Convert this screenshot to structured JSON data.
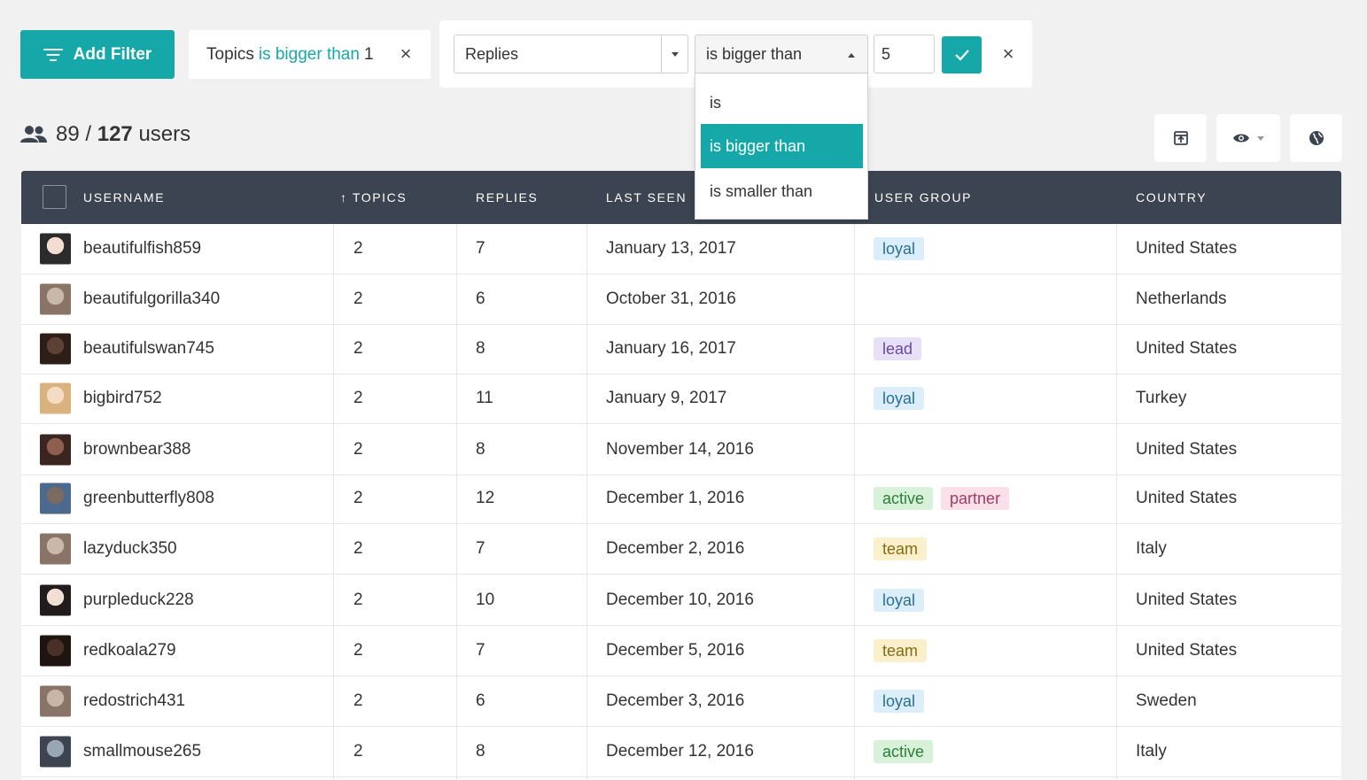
{
  "colors": {
    "accent": "#16a8a8",
    "header_bg": "#3b4450",
    "tag_loyal_bg": "#dbeefa",
    "tag_lead_bg": "#e8e0f7",
    "tag_active_bg": "#d7f2d9",
    "tag_partner_bg": "#fbe0ea",
    "tag_team_bg": "#fbf0cc"
  },
  "toolbar": {
    "add_filter_label": "Add Filter",
    "active_filter": {
      "field": "Topics",
      "operator": "is bigger than",
      "value": "1"
    }
  },
  "filter_editor": {
    "field_value": "Replies",
    "operator_value": "is bigger than",
    "value": "5",
    "operator_options": [
      "is",
      "is bigger than",
      "is smaller than"
    ],
    "selected_option_index": 1
  },
  "summary": {
    "shown": "89",
    "separator": "/",
    "total": "127",
    "unit": "users"
  },
  "table": {
    "columns": {
      "username": "USERNAME",
      "topics": "↑ TOPICS",
      "replies": "REPLIES",
      "last_seen": "LAST SEEN",
      "user_group": "USER GROUP",
      "country": "COUNTRY"
    },
    "rows": [
      {
        "username": "beautifulfish859",
        "topics": "2",
        "replies": "7",
        "last_seen": "January 13, 2017",
        "groups": [
          "loyal"
        ],
        "country": "United States"
      },
      {
        "username": "beautifulgorilla340",
        "topics": "2",
        "replies": "6",
        "last_seen": "October 31, 2016",
        "groups": [],
        "country": "Netherlands"
      },
      {
        "username": "beautifulswan745",
        "topics": "2",
        "replies": "8",
        "last_seen": "January 16, 2017",
        "groups": [
          "lead"
        ],
        "country": "United States"
      },
      {
        "username": "bigbird752",
        "topics": "2",
        "replies": "11",
        "last_seen": "January 9, 2017",
        "groups": [
          "loyal"
        ],
        "country": "Turkey"
      },
      {
        "username": "brownbear388",
        "topics": "2",
        "replies": "8",
        "last_seen": "November 14, 2016",
        "groups": [],
        "country": "United States"
      },
      {
        "username": "greenbutterfly808",
        "topics": "2",
        "replies": "12",
        "last_seen": "December 1, 2016",
        "groups": [
          "active",
          "partner"
        ],
        "country": "United States"
      },
      {
        "username": "lazyduck350",
        "topics": "2",
        "replies": "7",
        "last_seen": "December 2, 2016",
        "groups": [
          "team"
        ],
        "country": "Italy"
      },
      {
        "username": "purpleduck228",
        "topics": "2",
        "replies": "10",
        "last_seen": "December 10, 2016",
        "groups": [
          "loyal"
        ],
        "country": "United States"
      },
      {
        "username": "redkoala279",
        "topics": "2",
        "replies": "7",
        "last_seen": "December 5, 2016",
        "groups": [
          "team"
        ],
        "country": "United States"
      },
      {
        "username": "redostrich431",
        "topics": "2",
        "replies": "6",
        "last_seen": "December 3, 2016",
        "groups": [
          "loyal"
        ],
        "country": "Sweden"
      },
      {
        "username": "smallmouse265",
        "topics": "2",
        "replies": "8",
        "last_seen": "December 12, 2016",
        "groups": [
          "active"
        ],
        "country": "Italy"
      }
    ]
  }
}
